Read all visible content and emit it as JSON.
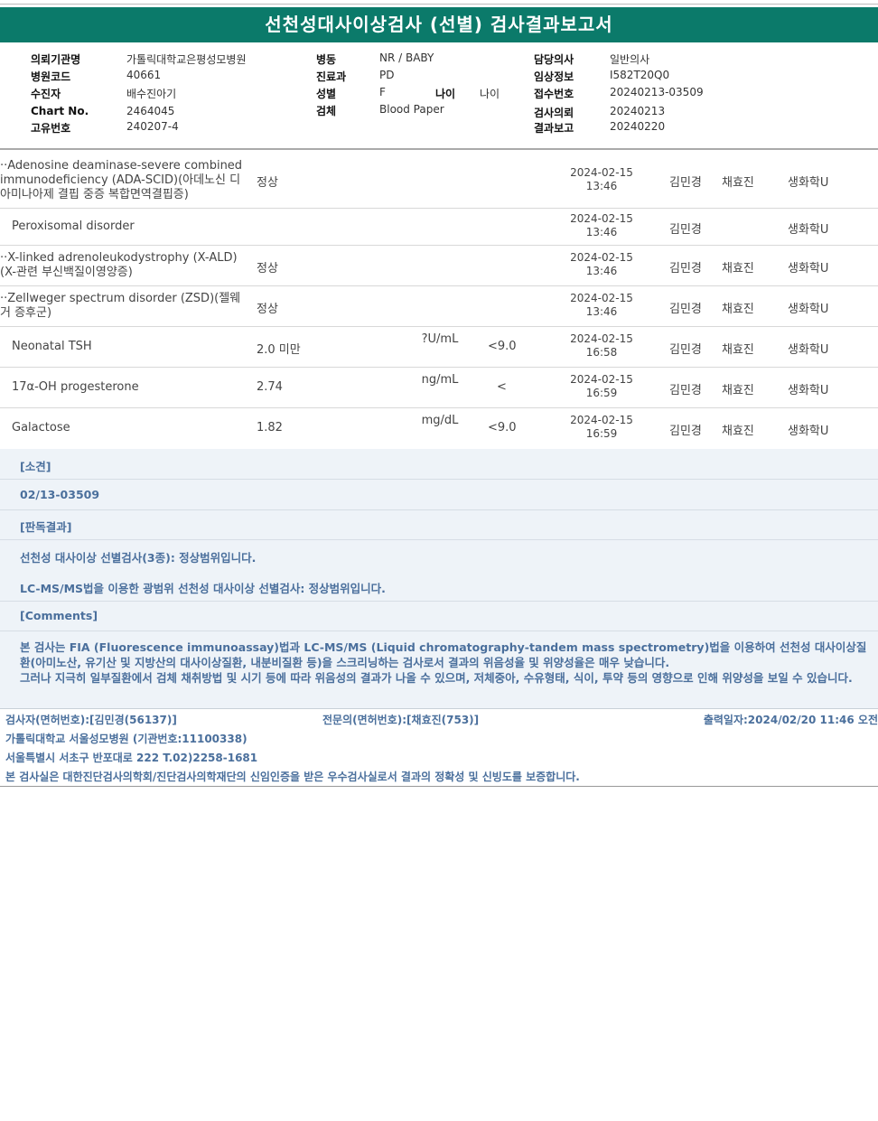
{
  "report": {
    "title": "선천성대사이상검사 (선별) 검사결과보고서"
  },
  "info": {
    "institution_label": "의뢰기관명",
    "institution": "가톨릭대학교은평성모병원",
    "hospital_code_label": "병원코드",
    "hospital_code": "40661",
    "patient_label": "수진자",
    "patient": "배수진아기",
    "chart_label": "Chart No.",
    "chart": "2464045",
    "unique_label": "고유번호",
    "unique": "240207-4",
    "ward_label": "병동",
    "ward": "NR / BABY",
    "dept_label": "진료과",
    "dept": "PD",
    "sex_label": "성별",
    "sex": "F",
    "age_label": "나이",
    "age": "나이",
    "specimen_label": "검체",
    "specimen": "Blood Paper",
    "doctor_label": "담당의사",
    "doctor": "일반의사",
    "clinical_label": "임상정보",
    "clinical": "I582T20Q0",
    "receipt_label": "접수번호",
    "receipt": "20240213-03509",
    "request_label": "검사의뢰",
    "request": "20240213",
    "report_label": "결과보고",
    "report": "20240220"
  },
  "results": [
    {
      "name": "··Adenosine deaminase-severe combined immunodeficiency (ADA-SCID)(아데노신 디아미나아제 결핍 중증 복합면역결핍증)",
      "result": "정상",
      "unit": "",
      "ref": "",
      "date": "2024-02-15",
      "time": "13:46",
      "p1": "김민경",
      "p2": "채효진",
      "dept": "생화학U"
    },
    {
      "name": "Peroxisomal disorder",
      "result": "",
      "unit": "",
      "ref": "",
      "date": "2024-02-15",
      "time": "13:46",
      "p1": "김민경",
      "p2": "",
      "dept": "생화학U"
    },
    {
      "name": "··X-linked adrenoleukodystrophy (X-ALD)(X-관련 부신백질이영양증)",
      "result": "정상",
      "unit": "",
      "ref": "",
      "date": "2024-02-15",
      "time": "13:46",
      "p1": "김민경",
      "p2": "채효진",
      "dept": "생화학U"
    },
    {
      "name": "··Zellweger spectrum disorder (ZSD)(젤웨거 증후군)",
      "result": "정상",
      "unit": "",
      "ref": "",
      "date": "2024-02-15",
      "time": "13:46",
      "p1": "김민경",
      "p2": "채효진",
      "dept": "생화학U"
    },
    {
      "name": "Neonatal TSH",
      "result": "2.0 미만",
      "unit": "?U/mL",
      "ref": "<9.0",
      "date": "2024-02-15",
      "time": "16:58",
      "p1": "김민경",
      "p2": "채효진",
      "dept": "생화학U"
    },
    {
      "name": "17α-OH progesterone",
      "result": "2.74",
      "unit": "ng/mL",
      "ref": "<",
      "date": "2024-02-15",
      "time": "16:59",
      "p1": "김민경",
      "p2": "채효진",
      "dept": "생화학U"
    },
    {
      "name": "Galactose",
      "result": "1.82",
      "unit": "mg/dL",
      "ref": "<9.0",
      "date": "2024-02-15",
      "time": "16:59",
      "p1": "김민경",
      "p2": "채효진",
      "dept": "생화학U"
    }
  ],
  "comments": {
    "finding_header": "[소견]",
    "receipt": "02/13-03509",
    "interpretation_header": "[판독결과]",
    "interpretation_1": "선천성 대사이상 선별검사(3종): 정상범위입니다.",
    "interpretation_2": "LC-MS/MS법을 이용한 광범위 선천성 대사이상 선별검사: 정상범위입니다.",
    "comments_header": "[Comments]",
    "comment_line_1": "본 검사는 FIA (Fluorescence immunoassay)법과 LC-MS/MS (Liquid chromatography-tandem mass spectrometry)법을 이용하여 선천성 대사이상질환(아미노산, 유기산 및 지방산의 대사이상질환, 내분비질환 등)을 스크리닝하는 검사로서 결과의 위음성율 및 위양성율은 매우 낮습니다.",
    "comment_line_2": "그러나 지극히 일부질환에서 검체 채취방법 및 시기 등에 따라 위음성의 결과가 나올 수 있으며, 저체중아, 수유형태, 식이, 투약 등의 영향으로 인해 위양성을 보일 수 있습니다."
  },
  "footer": {
    "tester": "검사자(면허번호):[김민경(56137)]",
    "specialist": "전문의(면허번호):[채효진(753)]",
    "printed": "출력일자:2024/02/20 11:46 오전",
    "hospital": "가톨릭대학교 서울성모병원 (기관번호:11100338)",
    "address": "서울특별시 서초구 반포대로 222 T.02)2258-1681",
    "certification": "본 검사실은 대한진단검사의학회/진단검사의학재단의 신임인증을 받은 우수검사실로서 결과의 정확성 및 신빙도를 보증합니다."
  }
}
